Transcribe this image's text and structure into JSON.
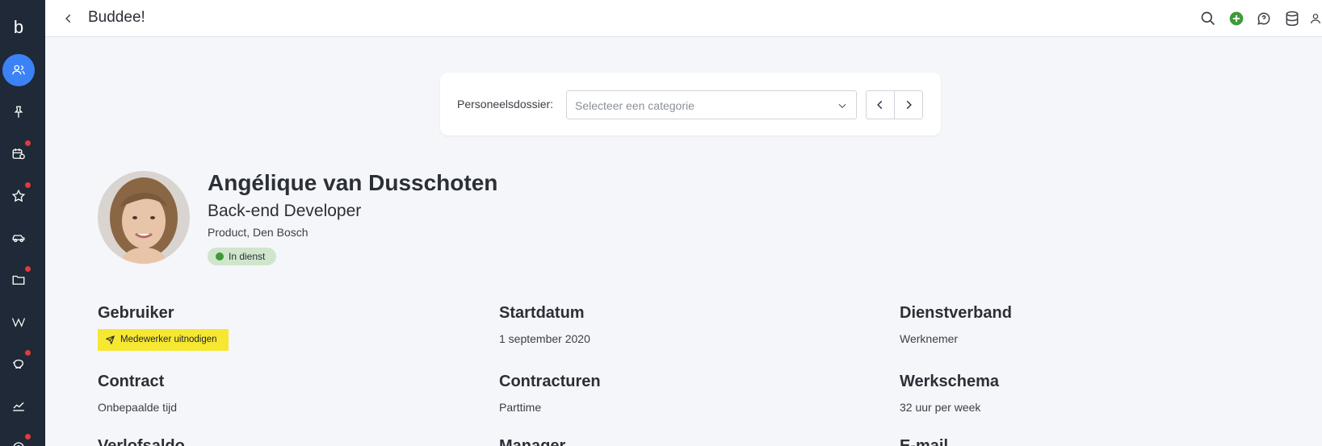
{
  "app": {
    "title": "Buddee!"
  },
  "sidebar": {
    "logo": "b",
    "items": [
      {
        "icon": "users-icon",
        "active": true,
        "badge": false
      },
      {
        "icon": "pin-icon",
        "active": false,
        "badge": false
      },
      {
        "icon": "calendar-clock-icon",
        "active": false,
        "badge": true
      },
      {
        "icon": "star-icon",
        "active": false,
        "badge": true
      },
      {
        "icon": "car-icon",
        "active": false,
        "badge": false
      },
      {
        "icon": "folder-icon",
        "active": false,
        "badge": true
      },
      {
        "icon": "wiki-icon",
        "active": false,
        "badge": false
      },
      {
        "icon": "piggy-bank-icon",
        "active": false,
        "badge": true
      },
      {
        "icon": "chart-icon",
        "active": false,
        "badge": false
      },
      {
        "icon": "settings-icon",
        "active": false,
        "badge": true
      }
    ]
  },
  "topbar": {
    "icons": [
      "search-icon",
      "add-icon",
      "chat-icon",
      "database-icon",
      "user-icon"
    ],
    "add_color": "#3f9a3a"
  },
  "dossier": {
    "label": "Personeelsdossier:",
    "placeholder": "Selecteer een categorie"
  },
  "profile": {
    "name": "Angélique van Dusschoten",
    "role": "Back-end Developer",
    "department": "Product, Den Bosch",
    "status": "In dienst",
    "status_color": "#3f9a3a"
  },
  "details": {
    "gebruiker_title": "Gebruiker",
    "invite_label": "Medewerker uitnodigen",
    "startdatum_title": "Startdatum",
    "startdatum_value": "1 september 2020",
    "dienstverband_title": "Dienstverband",
    "dienstverband_value": "Werknemer",
    "contract_title": "Contract",
    "contract_value": "Onbepaalde tijd",
    "contracturen_title": "Contracturen",
    "contracturen_value": "Parttime",
    "werkschema_title": "Werkschema",
    "werkschema_value": "32 uur per week",
    "verlofsaldo_title": "Verlofsaldo",
    "manager_title": "Manager",
    "email_title": "E-mail"
  },
  "colors": {
    "sidebar_bg": "#1f2937",
    "accent": "#3b82f6",
    "badge_red": "#e23b3b",
    "invite_yellow": "#f6e830"
  }
}
